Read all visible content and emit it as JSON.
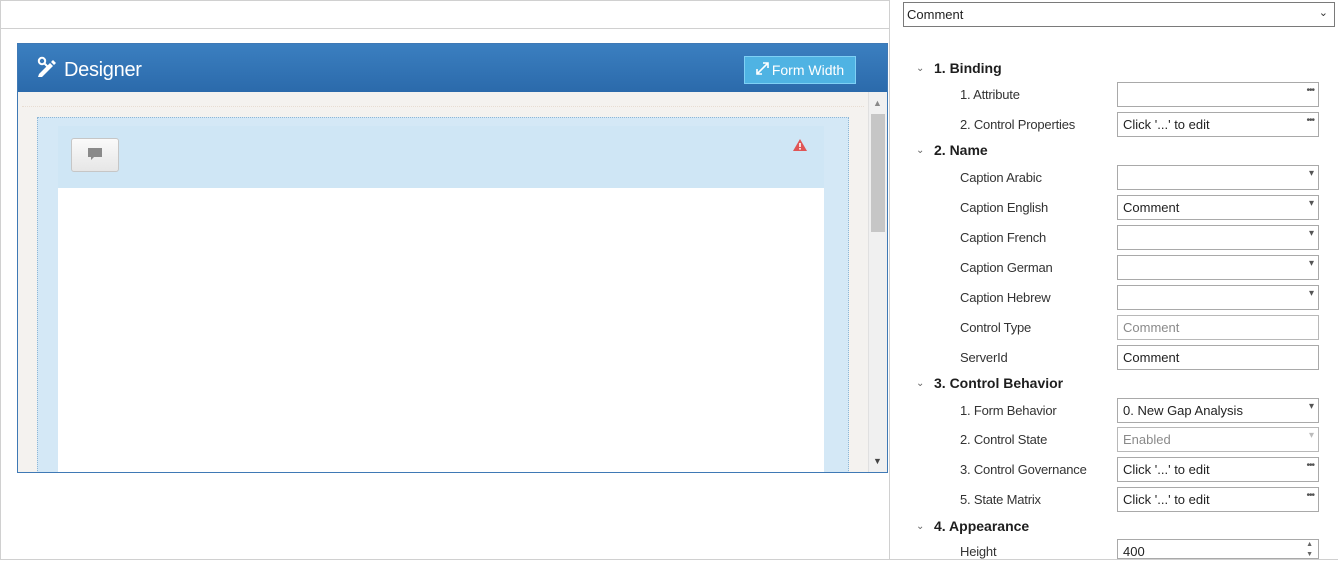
{
  "designer": {
    "title": "Designer",
    "form_width_label": "Form Width"
  },
  "properties": {
    "selected_element": "Comment",
    "sections": [
      {
        "label": "1. Binding"
      },
      {
        "label": "2. Name"
      },
      {
        "label": "3. Control Behavior"
      },
      {
        "label": "4. Appearance"
      }
    ],
    "rows": [
      {
        "label": "1. Attribute",
        "value": "",
        "editor": "ellipsis"
      },
      {
        "label": "2. Control Properties",
        "value": "Click '...' to edit",
        "editor": "ellipsis"
      },
      {
        "label": "Caption Arabic",
        "value": "",
        "editor": "dropdown"
      },
      {
        "label": "Caption English",
        "value": "Comment",
        "editor": "dropdown"
      },
      {
        "label": "Caption French",
        "value": "",
        "editor": "dropdown"
      },
      {
        "label": "Caption German",
        "value": "",
        "editor": "dropdown"
      },
      {
        "label": "Caption Hebrew",
        "value": "",
        "editor": "dropdown"
      },
      {
        "label": "Control Type",
        "value": "Comment",
        "editor": "readonly"
      },
      {
        "label": "ServerId",
        "value": "Comment",
        "editor": "text"
      },
      {
        "label": "1. Form Behavior",
        "value": "0. New Gap Analysis",
        "editor": "dropdown"
      },
      {
        "label": "2. Control State",
        "value": "Enabled",
        "editor": "dropdown-disabled"
      },
      {
        "label": "3. Control Governance",
        "value": "Click '...' to edit",
        "editor": "ellipsis"
      },
      {
        "label": "5. State Matrix",
        "value": "Click '...' to edit",
        "editor": "ellipsis"
      },
      {
        "label": "Height",
        "value": "400",
        "editor": "spinner"
      }
    ]
  },
  "colors": {
    "designer_header": "#2f70b1",
    "form_width_button": "#4fb3e3",
    "canvas": "#d4e8f6",
    "warning": "#e05555"
  },
  "icons": {
    "designer": "pencil-wrench-icon",
    "form_width": "resize-arrows-icon",
    "comment_control": "speech-bubble-icon",
    "warning": "warning-triangle-icon"
  }
}
